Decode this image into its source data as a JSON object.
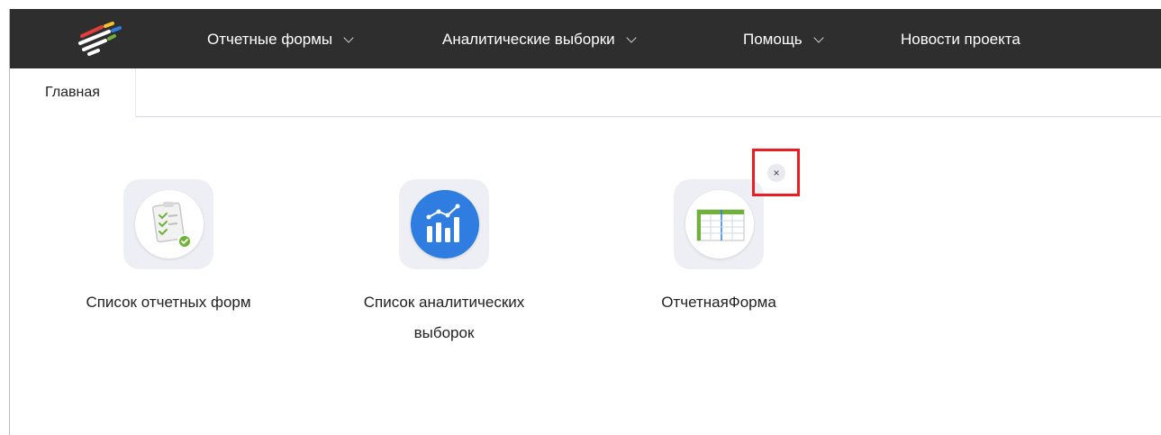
{
  "nav": {
    "items": [
      {
        "label": "Отчетные формы"
      },
      {
        "label": "Аналитические выборки"
      },
      {
        "label": "Помощь"
      },
      {
        "label": "Новости проекта"
      }
    ]
  },
  "tabs": [
    {
      "label": "Главная"
    }
  ],
  "tiles": [
    {
      "label_line1": "Список отчетных форм",
      "label_line2": "",
      "icon": "checklist-icon"
    },
    {
      "label_line1": "Список аналитических",
      "label_line2": "выборок",
      "icon": "bar-chart-icon"
    },
    {
      "label_line1": "ОтчетнаяФорма",
      "label_line2": "",
      "icon": "table-icon"
    }
  ],
  "close": {
    "symbol": "×"
  },
  "colors": {
    "navbar": "#2e2e2e",
    "highlight": "#ea1c24",
    "chart_blue": "#2f7de1",
    "check_green": "#6fb23a"
  }
}
